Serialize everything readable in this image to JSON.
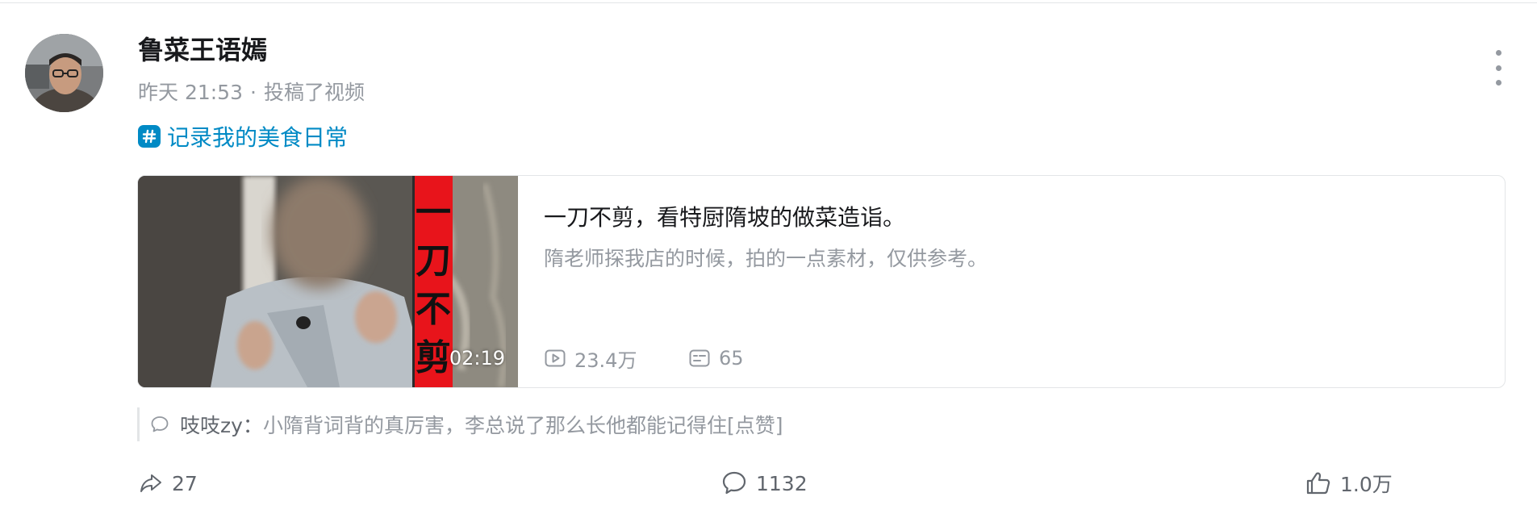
{
  "post": {
    "author_name": "鲁菜王语嫣",
    "time": "昨天 21:53",
    "dot": "·",
    "action": "投稿了视频",
    "topic": "记录我的美食日常"
  },
  "video": {
    "overlay_text": "一刀不剪",
    "duration": "02:19",
    "title": "一刀不剪，看特厨隋坡的做菜造诣。",
    "description": "隋老师探我店的时候，拍的一点素材，仅供参考。",
    "views": "23.4万",
    "danmaku": "65"
  },
  "hot_comment": {
    "user": "吱吱zy",
    "sep": "：",
    "text": "小隋背词背的真厉害，李总说了那么长他都能记得住[点赞]"
  },
  "actions": {
    "share": "27",
    "comment": "1132",
    "like": "1.0万"
  },
  "colors": {
    "accent": "#008ac5",
    "text_primary": "#18191c",
    "text_secondary": "#9499a0",
    "overlay_red": "#e8141b"
  }
}
